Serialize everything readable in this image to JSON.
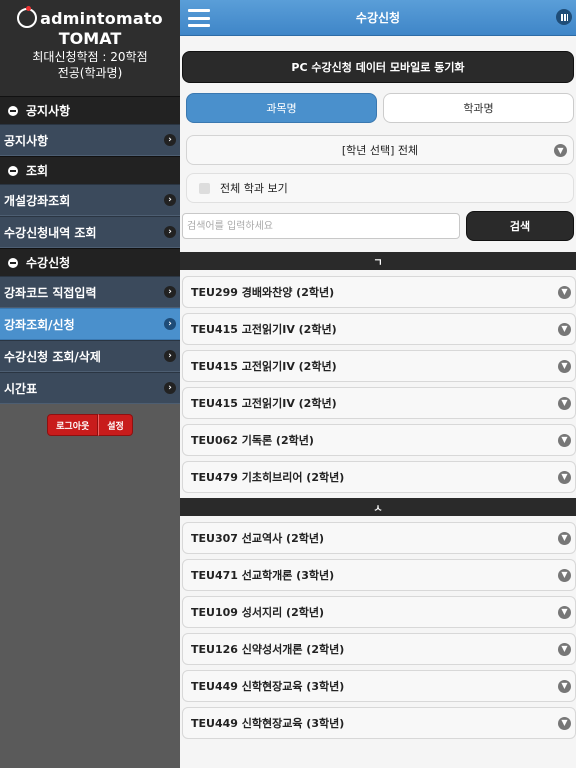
{
  "sidebar": {
    "brand": "admintomato",
    "brand_sub": "TOMAT",
    "info_line1": "최대신청학점 : 20학점",
    "info_line2": "전공(학과명)",
    "sections": [
      {
        "header": "공지사항",
        "items": [
          {
            "label": "공지사항",
            "active": false
          }
        ]
      },
      {
        "header": "조회",
        "items": [
          {
            "label": "개설강좌조회",
            "active": false
          },
          {
            "label": "수강신청내역 조회",
            "active": false
          }
        ]
      },
      {
        "header": "수강신청",
        "items": [
          {
            "label": "강좌코드 직접입력",
            "active": false
          },
          {
            "label": "강좌조회/신청",
            "active": true
          },
          {
            "label": "수강신청 조회/삭제",
            "active": false
          },
          {
            "label": "시간표",
            "active": false
          }
        ]
      }
    ],
    "logout_label": "로그아웃",
    "settings_label": "설정"
  },
  "header": {
    "title": "수강신청"
  },
  "main": {
    "sync_label": "PC 수강신청 데이터 모바일로 동기화",
    "tabs": [
      {
        "label": "과목명",
        "active": true
      },
      {
        "label": "학과명",
        "active": false
      }
    ],
    "grade_select": "[학년 선택] 전체",
    "show_all_label": "전체 학과 보기",
    "search_placeholder": "검색어를 입력하세요",
    "search_label": "검색",
    "group1_divider": "ㄱ",
    "group1": [
      "TEU299 경배와찬양 (2학년)",
      "TEU415 고전읽기IV (2학년)",
      "TEU415 고전읽기IV (2학년)",
      "TEU415 고전읽기IV (2학년)",
      "TEU062 기독론 (2학년)",
      "TEU479 기초히브리어 (2학년)"
    ],
    "group2_divider": "ㅅ",
    "group2": [
      "TEU307 선교역사 (2학년)",
      "TEU471 선교학개론 (3학년)",
      "TEU109 성서지리 (2학년)",
      "TEU126 신약성서개론 (2학년)",
      "TEU449 신학현장교육 (3학년)",
      "TEU449 신학현장교육 (3학년)"
    ]
  }
}
